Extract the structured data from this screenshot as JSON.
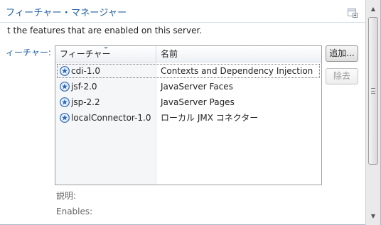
{
  "header": {
    "title": "フィーチャー・マネージャー",
    "description": "t the features that are enabled on this server."
  },
  "features": {
    "label": "ィーチャー:",
    "columns": [
      "フィーチャー",
      "名前"
    ],
    "rows": [
      {
        "feature": "cdi-1.0",
        "name": "Contexts and Dependency Injection",
        "icon": "feature-star-icon",
        "selected": true
      },
      {
        "feature": "jsf-2.0",
        "name": "JavaServer Faces",
        "icon": "feature-star-icon"
      },
      {
        "feature": "jsp-2.2",
        "name": "JavaServer Pages",
        "icon": "feature-star-icon"
      },
      {
        "feature": "localConnector-1.0",
        "name": "ローカル JMX コネクター",
        "icon": "feature-star-icon"
      }
    ]
  },
  "buttons": {
    "add_label": "追加...",
    "remove_label": "除去",
    "remove_enabled": false
  },
  "details": {
    "description_label": "説明:",
    "enables_label": "Enables:"
  },
  "colors": {
    "accent": "#1f5fa5",
    "icon_blue": "#2b66b8"
  }
}
